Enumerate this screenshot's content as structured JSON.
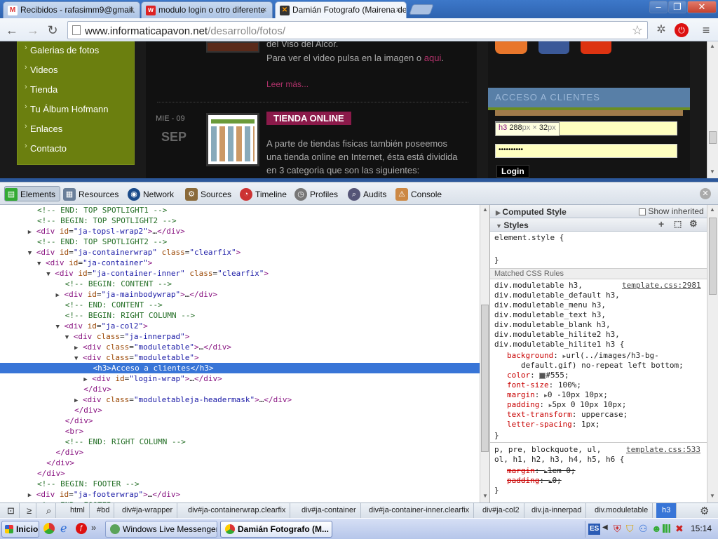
{
  "browser": {
    "tabs": [
      {
        "title": "Recibidos - rafasimm9@gmail.",
        "icon": "gmail-icon"
      },
      {
        "title": "modulo login o otro diferente",
        "icon": "webhost-icon"
      },
      {
        "title": "Damián Fotografo (Mairena de",
        "icon": "joomla-icon"
      }
    ],
    "url_host": "www.informaticapavon.net",
    "url_path": "/desarrollo/fotos/"
  },
  "webpage": {
    "nav_items": [
      "Galerias de fotos",
      "Videos",
      "Tienda",
      "Tu Álbum Hofmann",
      "Enlaces",
      "Contacto"
    ],
    "post1": {
      "line1": "del Viso del Alcor.",
      "line2": "Para ver el video pulsa en la imagen o ",
      "link": "aqui",
      "line2_end": ".",
      "read_more": "Leer más..."
    },
    "post2": {
      "day": "MIE - 09",
      "month": "SEP",
      "title": "TIENDA ONLINE",
      "text": [
        "A parte de tiendas fisicas también poseemos",
        "una tienda online en Internet, ésta está dividida",
        "en 3 categoria que son las siguientes:"
      ]
    },
    "login": {
      "heading": "ACCESO A CLIENTES",
      "tooltip_tag": "h3",
      "tooltip_w": "288",
      "tooltip_h": "32",
      "tooltip_unit": "px",
      "tooltip_x": "×",
      "password_mask": "••••••••••",
      "button": "Login"
    }
  },
  "devtools": {
    "tabs": [
      "Elements",
      "Resources",
      "Network",
      "Sources",
      "Timeline",
      "Profiles",
      "Audits",
      "Console"
    ],
    "styles_panel": {
      "computed_header": "Computed Style",
      "show_inherited": "Show inherited",
      "styles_header": "Styles",
      "element_style": "element.style {",
      "close_brace": "}",
      "matched_rules": "Matched CSS Rules",
      "rule1_selectors": [
        "div.moduletable h3,",
        "div.moduletable_default h3,",
        "div.moduletable_menu h3,",
        "div.moduletable_text h3,",
        "div.moduletable_blank h3,",
        "div.moduletable_hilite2 h3,",
        "div.moduletable_hilite1 h3 {"
      ],
      "rule1_source": "template.css:2981",
      "rule1_props": [
        {
          "name": "background",
          "value": "url(../images/h3-bg-"
        },
        {
          "name": "",
          "value": "default.gif) no-repeat left bottom;"
        },
        {
          "name": "color",
          "value": "#555;"
        },
        {
          "name": "font-size",
          "value": "100%;"
        },
        {
          "name": "margin",
          "value": "0 -10px 10px;"
        },
        {
          "name": "padding",
          "value": "5px 0 10px 10px;"
        },
        {
          "name": "text-transform",
          "value": "uppercase;"
        },
        {
          "name": "letter-spacing",
          "value": "1px;"
        }
      ],
      "rule2_selectors": [
        "p, pre, blockquote, ul,",
        "ol, h1, h2, h3, h4, h5, h6 {"
      ],
      "rule2_source": "template.css:533",
      "rule2_props": [
        {
          "name": "margin",
          "value": "1em 0;"
        },
        {
          "name": "padding",
          "value": "0;"
        }
      ]
    },
    "breadcrumbs": [
      "html",
      "#bd",
      "div#ja-wrapper",
      "div#ja-containerwrap.clearfix",
      "div#ja-container",
      "div#ja-container-inner.clearfix",
      "div#ja-col2",
      "div.ja-innerpad",
      "div.moduletable",
      "h3"
    ]
  },
  "taskbar": {
    "start": "Inicio",
    "items": [
      "Windows Live Messenger",
      "Damián Fotografo (M..."
    ],
    "lang": "ES",
    "time": "15:14"
  }
}
